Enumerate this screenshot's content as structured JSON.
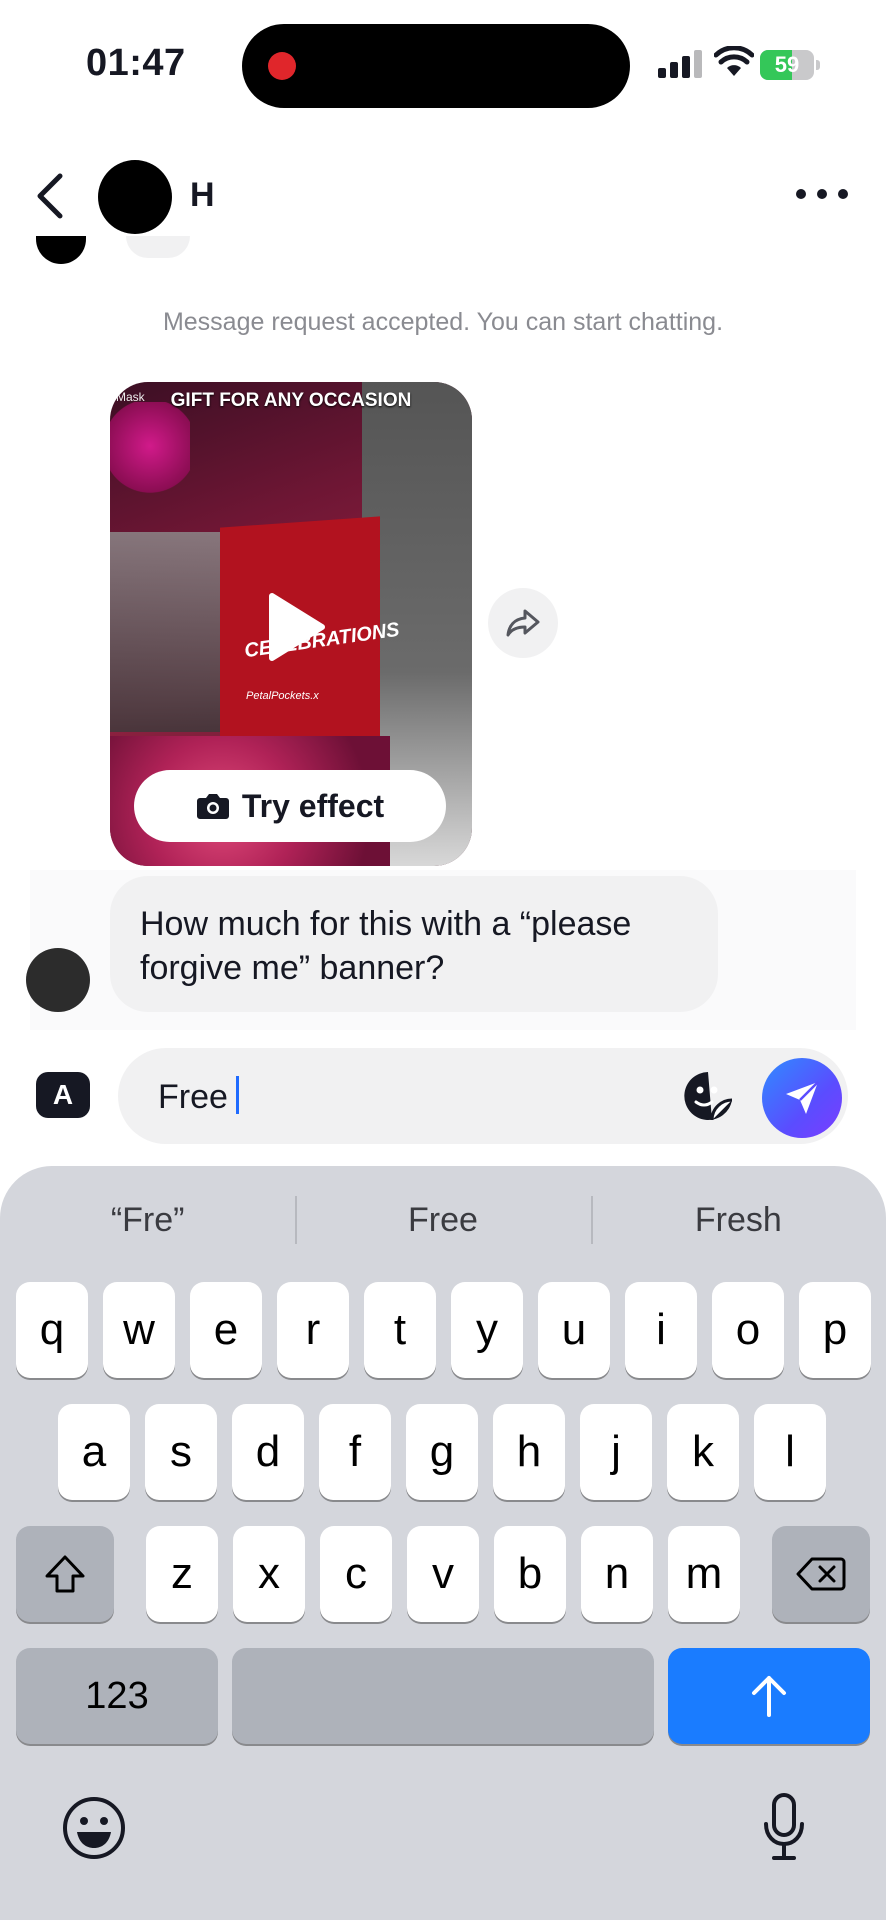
{
  "status_bar": {
    "time": "01:47",
    "battery": "59",
    "battery_level": 0.59,
    "battery_color": "#34c759",
    "recording_color": "#e0262b"
  },
  "header": {
    "name": "H"
  },
  "system_message": "Message request accepted. You can start chatting.",
  "video_card": {
    "caption": "GIFT FOR ANY OCCASION",
    "label": "Mask",
    "watermark": "PetalPockets.x",
    "brand": "CELEBRATIONS",
    "try_effect_label": "Try effect"
  },
  "messages": [
    {
      "text": "How much for this with a “please forgive me” banner?"
    }
  ],
  "composer": {
    "font_button_label": "A",
    "text": "Free",
    "send_color": "#5a4dff"
  },
  "keyboard": {
    "suggestions": [
      "“Fre”",
      "Free",
      "Fresh"
    ],
    "row1": [
      "q",
      "w",
      "e",
      "r",
      "t",
      "y",
      "u",
      "i",
      "o",
      "p"
    ],
    "row2": [
      "a",
      "s",
      "d",
      "f",
      "g",
      "h",
      "j",
      "k",
      "l"
    ],
    "row3": [
      "z",
      "x",
      "c",
      "v",
      "b",
      "n",
      "m"
    ],
    "numbers_label": "123",
    "return_color": "#1a7cff"
  }
}
